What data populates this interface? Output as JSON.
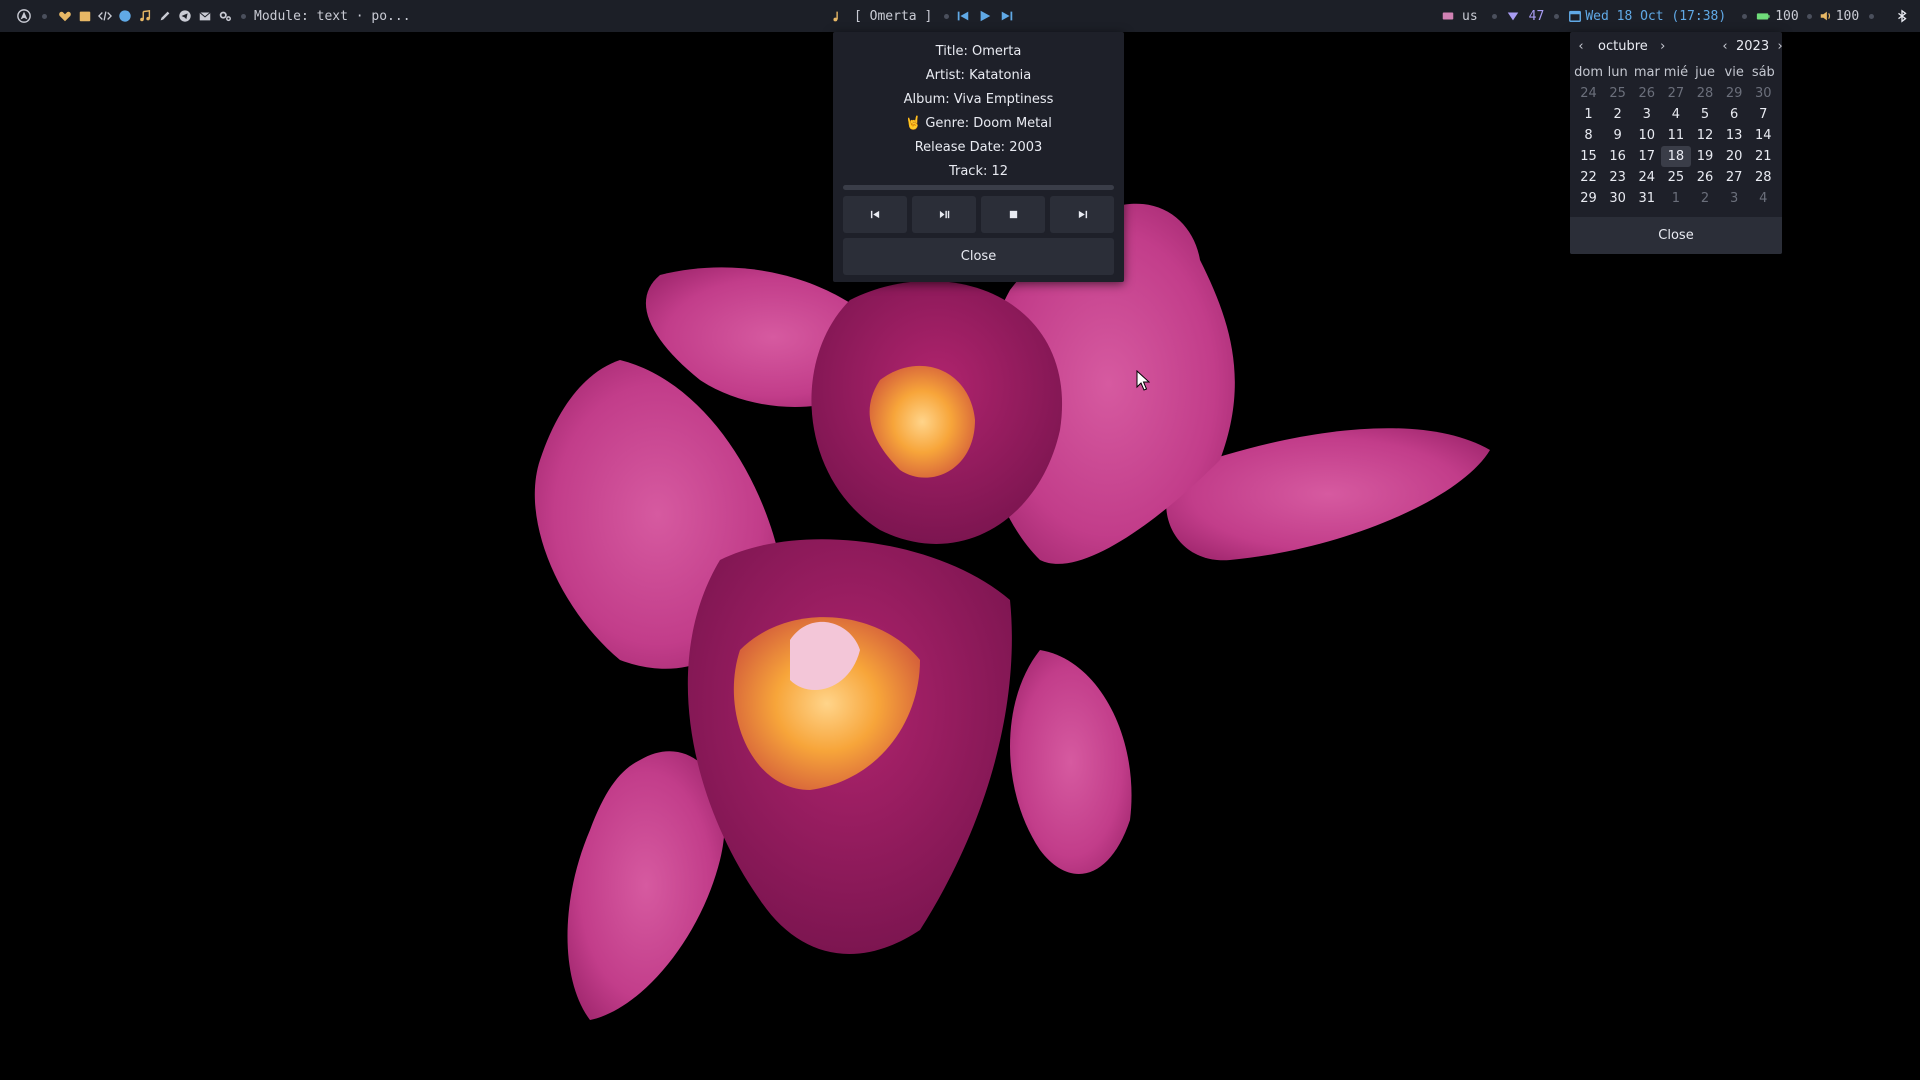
{
  "topbar": {
    "workspace_module": "Module: text · po...",
    "now_playing": "[ Omerta ]",
    "keyboard_layout": "us",
    "vpn_value": "47",
    "datetime": "Wed 18 Oct (17:38)",
    "battery": "100",
    "volume": "100",
    "launcher_icons": [
      "heart-icon",
      "folder-icon",
      "code-icon",
      "globe-icon",
      "music-note-icon",
      "pen-icon",
      "telegram-icon",
      "mail-icon",
      "settings-icon"
    ],
    "colors": {
      "bar_bg": "#1c1f27",
      "accent_blue": "#60a9e6",
      "battery_green": "#6fdc7a",
      "vpn_purple": "#a89cf2"
    }
  },
  "music_popup": {
    "title": "Title: Omerta",
    "artist": "Artist: Katatonia",
    "album": "Album: Viva Emptiness",
    "genre_emoji": "🤘",
    "genre": "Genre: Doom Metal",
    "release_date": "Release Date: 2003",
    "track": "Track: 12",
    "progress_fraction": 0.0,
    "controls": [
      "previous-icon",
      "play-pause-icon",
      "stop-icon",
      "next-icon"
    ],
    "close_label": "Close"
  },
  "calendar_popup": {
    "month": "octubre",
    "year": "2023",
    "weekdays": [
      "dom",
      "lun",
      "mar",
      "mié",
      "jue",
      "vie",
      "sáb"
    ],
    "weeks": [
      [
        "24",
        "25",
        "26",
        "27",
        "28",
        "29",
        "30"
      ],
      [
        "1",
        "2",
        "3",
        "4",
        "5",
        "6",
        "7"
      ],
      [
        "8",
        "9",
        "10",
        "11",
        "12",
        "13",
        "14"
      ],
      [
        "15",
        "16",
        "17",
        "18",
        "19",
        "20",
        "21"
      ],
      [
        "22",
        "23",
        "24",
        "25",
        "26",
        "27",
        "28"
      ],
      [
        "29",
        "30",
        "31",
        "1",
        "2",
        "3",
        "4"
      ]
    ],
    "selected_day": "18",
    "close_label": "Close"
  }
}
